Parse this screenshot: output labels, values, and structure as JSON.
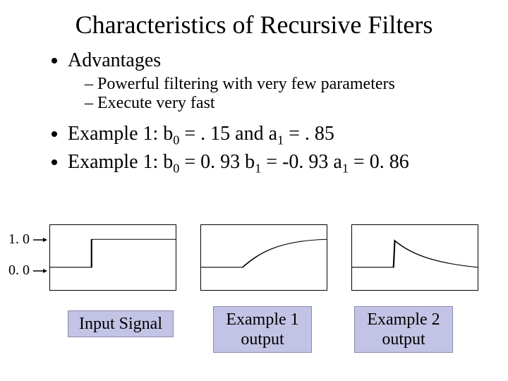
{
  "title": "Characteristics of Recursive Filters",
  "bullets": {
    "advantages": "Advantages",
    "sub": {
      "s1": "Powerful filtering with very few parameters",
      "s2": "Execute very fast"
    },
    "ex1_pre": "Example 1: b",
    "ex1_mid": " = . 15 and a",
    "ex1_post": " = . 85",
    "ex2_pre": "Example 1: b",
    "ex2_mid1": " = 0. 93 b",
    "ex2_mid2": " = -0. 93 a",
    "ex2_post": " = 0. 86",
    "sub0": "0",
    "sub1": "1"
  },
  "axis": {
    "y1": "1. 0",
    "y0": "0. 0"
  },
  "captions": {
    "c1": "Input Signal",
    "c2": "Example 1 output",
    "c3": "Example 2 output"
  },
  "chart_data": [
    {
      "type": "line",
      "title": "Input Signal",
      "xlabel": "",
      "ylabel": "",
      "ylim": [
        0,
        1
      ],
      "x": [
        0,
        0.33,
        0.33,
        1.0
      ],
      "values": [
        0,
        0,
        1,
        1
      ]
    },
    {
      "type": "line",
      "title": "Example 1 output",
      "xlabel": "",
      "ylabel": "",
      "ylim": [
        0,
        1
      ],
      "x": [
        0,
        0.33,
        0.4,
        0.5,
        0.6,
        0.7,
        0.8,
        0.9,
        1.0
      ],
      "values": [
        0,
        0,
        0.4,
        0.7,
        0.85,
        0.93,
        0.97,
        0.99,
        1.0
      ]
    },
    {
      "type": "line",
      "title": "Example 2 output",
      "xlabel": "",
      "ylabel": "",
      "ylim": [
        0,
        1
      ],
      "x": [
        0,
        0.33,
        0.34,
        0.4,
        0.5,
        0.6,
        0.7,
        0.8,
        0.9,
        1.0
      ],
      "values": [
        0,
        0,
        0.93,
        0.6,
        0.4,
        0.25,
        0.15,
        0.08,
        0.03,
        0.0
      ]
    }
  ]
}
